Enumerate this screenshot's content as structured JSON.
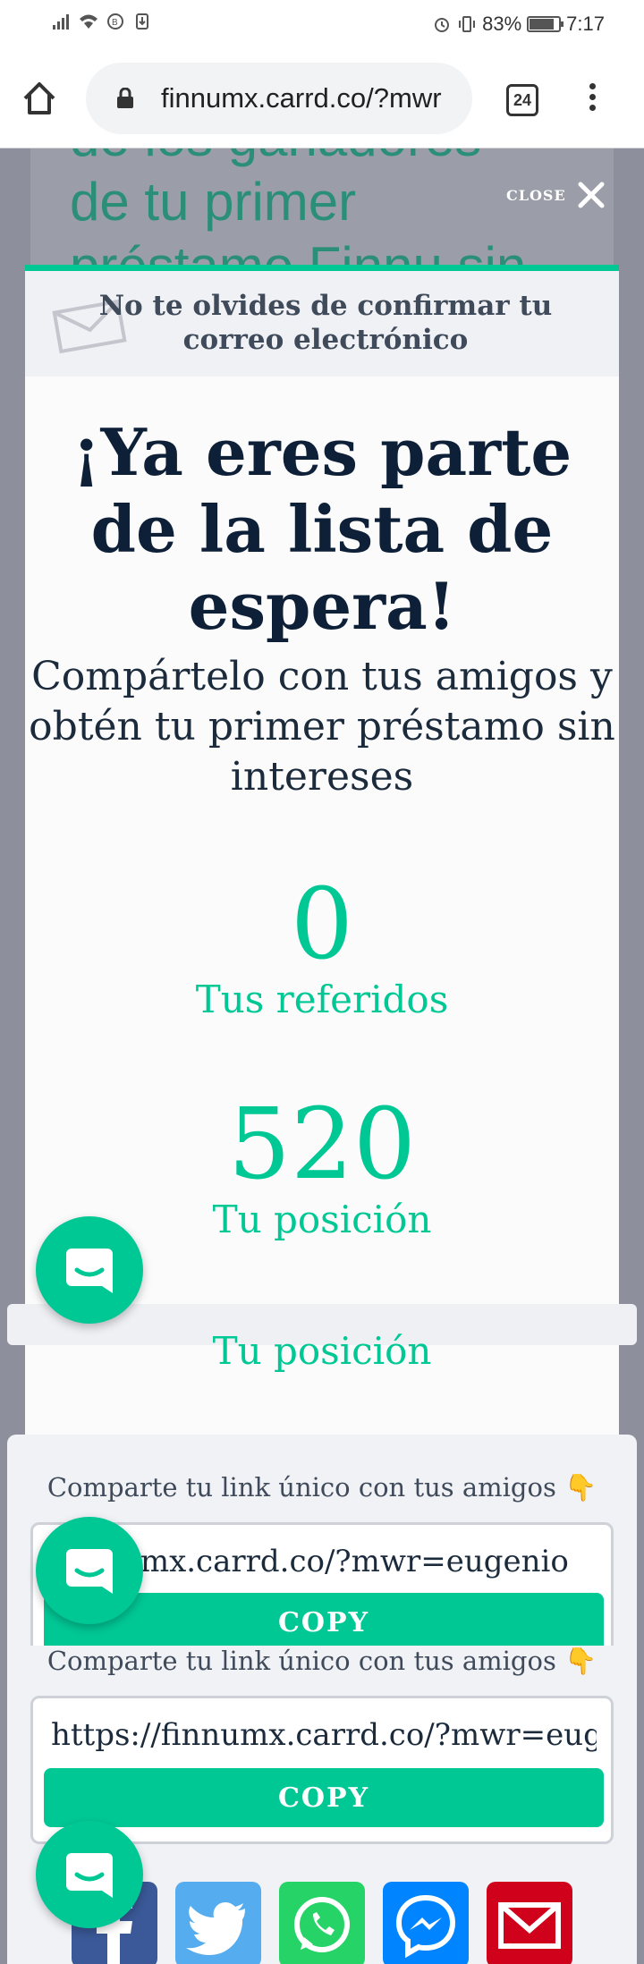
{
  "status_bar": {
    "battery": "83%",
    "time": "7:17"
  },
  "browser": {
    "url": "finnumx.carrd.co/?mwr",
    "tab_count": "24"
  },
  "background_page": {
    "heading_lines": [
      "de los ganadores",
      "de tu primer",
      "préstamo Finnu sin"
    ],
    "close_label": "CLOSE"
  },
  "modal": {
    "confirm_notice": "No te olvides de confirmar tu correo electrónico",
    "headline": "¡Ya eres parte de la lista de espera!",
    "subtext": "Compártelo con tus amigos y obtén tu primer préstamo sin intereses",
    "referrals": {
      "value": "0",
      "label": "Tus referidos"
    },
    "position": {
      "value": "520",
      "label": "Tu posición"
    }
  },
  "share": {
    "title": "Comparte tu link único con tus amigos 👇",
    "link_value": "https://finnumx.carrd.co/?mwr=eugenio",
    "link_value_scrolled": "/finnumx.carrd.co/?mwr=eugenio",
    "copy_label": "COPY",
    "networks": [
      "facebook",
      "twitter",
      "whatsapp",
      "messenger",
      "email"
    ]
  },
  "colors": {
    "accent": "#00c895",
    "headline": "#0e2038",
    "notice_bg": "#f0f1f5"
  }
}
